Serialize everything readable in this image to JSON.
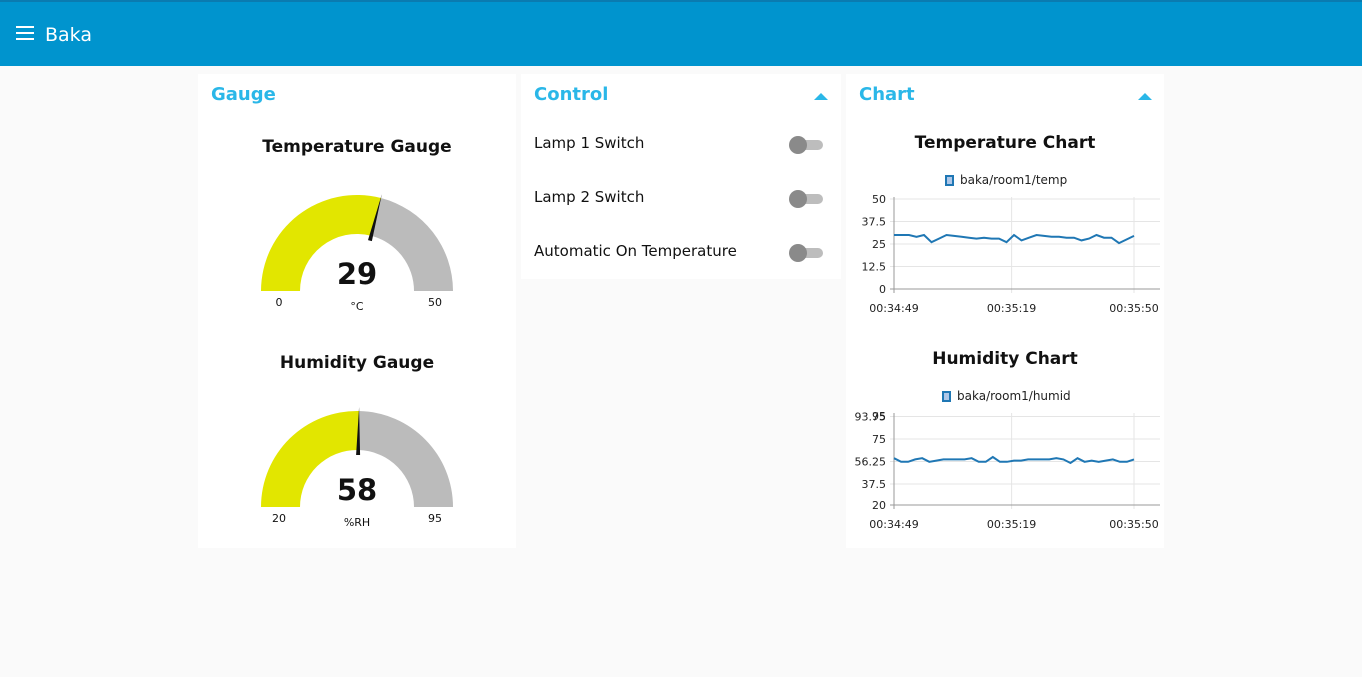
{
  "header": {
    "title": "Baka",
    "menu_icon": "hamburger-icon"
  },
  "gauge_card": {
    "title": "Gauge",
    "temperature": {
      "title": "Temperature Gauge",
      "value": "29",
      "unit": "°C",
      "min": "0",
      "max": "50",
      "min_num": 0,
      "max_num": 50,
      "value_num": 29,
      "fill_color": "#e2e600",
      "rest_color": "#bbbbbb"
    },
    "humidity": {
      "title": "Humidity Gauge",
      "value": "58",
      "unit": "%RH",
      "min": "20",
      "max": "95",
      "min_num": 20,
      "max_num": 95,
      "value_num": 58,
      "fill_color": "#e2e600",
      "rest_color": "#bbbbbb"
    }
  },
  "control_card": {
    "title": "Control",
    "switches": [
      {
        "label": "Lamp 1 Switch",
        "state": "off"
      },
      {
        "label": "Lamp 2 Switch",
        "state": "off"
      },
      {
        "label": "Automatic On Temperature",
        "state": "off"
      }
    ]
  },
  "chart_card": {
    "title": "Chart"
  },
  "colors": {
    "accent": "#0094ce",
    "title": "#2ab7e8",
    "series": "#1f77b4"
  },
  "chart_data": [
    {
      "type": "line",
      "title": "Temperature Chart",
      "legend": "baka/room1/temp",
      "ylim": [
        0,
        50
      ],
      "yticks": [
        "50",
        "37.5",
        "25",
        "12.5",
        "0"
      ],
      "xticks": [
        "00:34:49",
        "00:35:19",
        "00:35:50"
      ],
      "series": [
        {
          "name": "baka/room1/temp",
          "values": [
            30,
            30,
            30,
            29,
            30,
            26,
            28,
            30,
            29.5,
            29,
            28.5,
            28,
            28.5,
            28,
            28,
            26,
            30,
            27,
            28.5,
            30,
            29.5,
            29,
            29,
            28.5,
            28.5,
            27,
            28,
            30,
            28.5,
            28.5,
            25.5,
            27.5,
            29.5
          ]
        }
      ]
    },
    {
      "type": "line",
      "title": "Humidity Chart",
      "legend": "baka/room1/humid",
      "ylim": [
        20,
        95
      ],
      "yticks": [
        "95",
        "93.75",
        "75",
        "56.25",
        "37.5",
        "20"
      ],
      "xticks": [
        "00:34:49",
        "00:35:19",
        "00:35:50"
      ],
      "series": [
        {
          "name": "baka/room1/humid",
          "values": [
            59,
            56,
            56,
            58,
            59,
            56,
            57,
            58,
            58,
            58,
            58,
            59,
            56,
            56,
            60,
            56,
            56,
            57,
            57,
            58,
            58,
            58,
            58,
            59,
            58,
            55,
            59,
            56,
            57,
            56,
            57,
            58,
            56,
            56,
            58
          ]
        }
      ]
    }
  ]
}
